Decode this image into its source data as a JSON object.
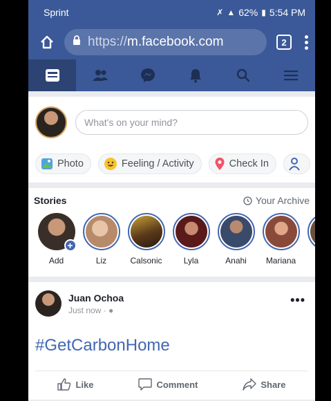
{
  "status": {
    "carrier": "Sprint",
    "battery": "62%",
    "time": "5:54 PM"
  },
  "browser": {
    "url_scheme": "https://",
    "url_host": "m.facebook.com",
    "tab_count": "2"
  },
  "composer": {
    "placeholder": "What's on your mind?",
    "actions": [
      "Photo",
      "Feeling / Activity",
      "Check In"
    ]
  },
  "stories": {
    "title": "Stories",
    "archive_label": "Your Archive",
    "items": [
      {
        "label": "Add",
        "color": "#3a2e28"
      },
      {
        "label": "Liz",
        "color": "#caa07e"
      },
      {
        "label": "Calsonic",
        "color": "#8a6a2a"
      },
      {
        "label": "Lyla",
        "color": "#7a2a2a"
      },
      {
        "label": "Anahi",
        "color": "#4a5a7a"
      },
      {
        "label": "Mariana",
        "color": "#9a5a4a"
      }
    ]
  },
  "post": {
    "author": "Juan Ochoa",
    "time": "Just now ·",
    "more": "•••",
    "text": "#GetCarbonHome",
    "actions": {
      "like": "Like",
      "comment": "Comment",
      "share": "Share"
    }
  },
  "colors": {
    "brand": "#3b5998",
    "accent": "#4267b2"
  }
}
